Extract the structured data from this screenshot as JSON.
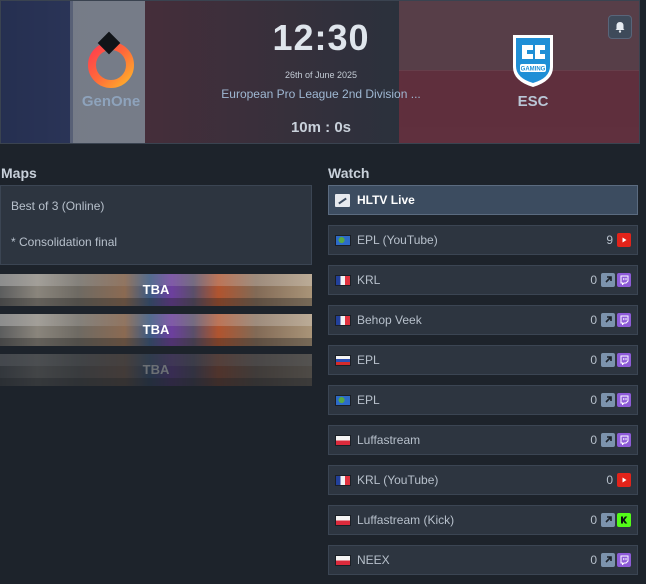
{
  "match": {
    "time": "12:30",
    "date": "26th of June 2025",
    "event": "European Pro League 2nd Division ...",
    "countdown": "10m : 0s",
    "team_left": "GenOne",
    "team_right": "ESC",
    "team_right_logo_text": "GAMING"
  },
  "maps": {
    "title": "Maps",
    "format": "Best of 3 (Online)",
    "note": "* Consolidation final",
    "items": [
      {
        "label": "TBA",
        "dim": false
      },
      {
        "label": "TBA",
        "dim": false
      },
      {
        "label": "TBA",
        "dim": true
      }
    ]
  },
  "watch": {
    "title": "Watch",
    "hltv_label": "HLTV Live",
    "streams": [
      {
        "flag": "world",
        "name": "EPL (YouTube)",
        "viewers": "9",
        "icons": [
          "youtube-icon"
        ]
      },
      {
        "flag": "fr",
        "name": "KRL",
        "viewers": "0",
        "icons": [
          "external-link-icon",
          "twitch-icon"
        ]
      },
      {
        "flag": "fr",
        "name": "Behop Veek",
        "viewers": "0",
        "icons": [
          "external-link-icon",
          "twitch-icon"
        ]
      },
      {
        "flag": "ru",
        "name": "EPL",
        "viewers": "0",
        "icons": [
          "external-link-icon",
          "twitch-icon"
        ]
      },
      {
        "flag": "world",
        "name": "EPL",
        "viewers": "0",
        "icons": [
          "external-link-icon",
          "twitch-icon"
        ]
      },
      {
        "flag": "pl",
        "name": "Luffastream",
        "viewers": "0",
        "icons": [
          "external-link-icon",
          "twitch-icon"
        ]
      },
      {
        "flag": "fr",
        "name": "KRL (YouTube)",
        "viewers": "0",
        "icons": [
          "youtube-icon"
        ]
      },
      {
        "flag": "pl",
        "name": "Luffastream (Kick)",
        "viewers": "0",
        "icons": [
          "external-link-icon",
          "kick-icon"
        ]
      },
      {
        "flag": "pl",
        "name": "NEEX",
        "viewers": "0",
        "icons": [
          "external-link-icon",
          "twitch-icon"
        ]
      }
    ]
  }
}
